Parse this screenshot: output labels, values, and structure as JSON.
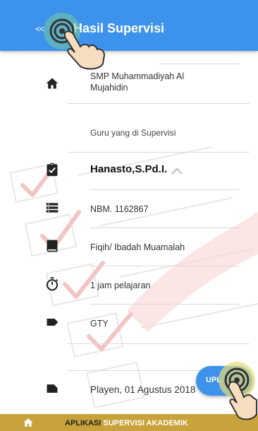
{
  "appbar": {
    "back_label": "<<",
    "title": "Hasil Supervisi",
    "color": "#3d93ec"
  },
  "items": {
    "school": {
      "icon": "home-icon",
      "text": "SMP Muhammadiyah Al Mujahidin"
    },
    "section_title": "Guru yang di Supervisi",
    "teacher": {
      "icon": "clipboard-check-icon",
      "name": "Hanasto,S.Pd.I.",
      "toggle_icon": "chevron-up-icon"
    },
    "nbm": {
      "icon": "list-icon",
      "text": "NBM. 1162867"
    },
    "subject": {
      "icon": "book-icon",
      "text": "Fiqih/ Ibadah Muamalah"
    },
    "duration": {
      "icon": "timer-icon",
      "text": "1 jam pelajaran"
    },
    "status": {
      "icon": "label-icon",
      "text": "GTY"
    },
    "date": {
      "icon": "label-icon",
      "text": "Playen, 01 Agustus 2018"
    }
  },
  "fab": {
    "label": "UPL"
  },
  "bottombar": {
    "icon": "home-icon",
    "label_part1": "APLIKASI",
    "label_part2": "SUPERVISI AKADEMIK",
    "color": "#c8a23a"
  }
}
